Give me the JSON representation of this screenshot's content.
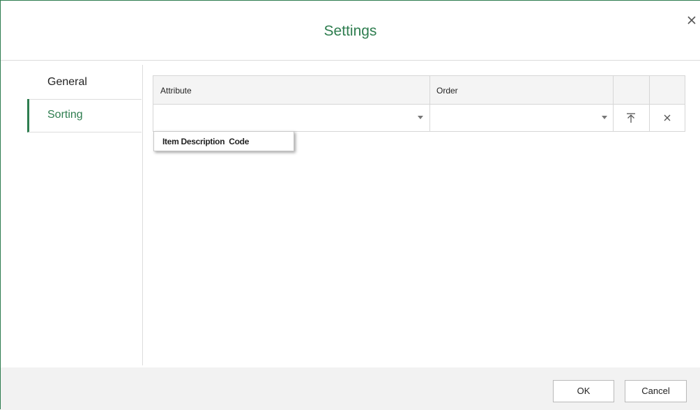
{
  "dialog": {
    "title": "Settings",
    "close_icon": "close-icon"
  },
  "sidebar": {
    "items": [
      {
        "label": "General",
        "active": false
      },
      {
        "label": "Sorting",
        "active": true
      }
    ]
  },
  "grid": {
    "columns": [
      "Attribute",
      "Order",
      "",
      ""
    ],
    "rows": [
      {
        "attribute_value": "",
        "order_value": "",
        "move_top_icon": "move-to-top-icon",
        "delete_icon": "delete-row-icon"
      }
    ]
  },
  "attribute_dropdown": {
    "options": [
      "Item Description  Code"
    ]
  },
  "footer": {
    "ok_label": "OK",
    "cancel_label": "Cancel"
  },
  "colors": {
    "accent": "#2e7d4f",
    "border": "#d6d6d6",
    "header_bg": "#f4f4f4",
    "footer_bg": "#f2f2f2"
  }
}
